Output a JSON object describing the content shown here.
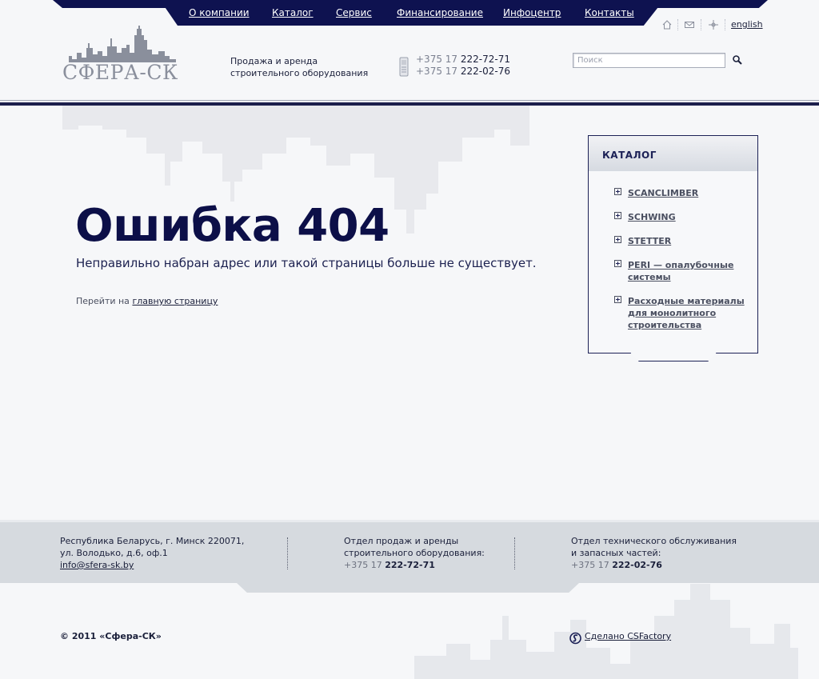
{
  "nav": {
    "items": [
      {
        "label": "О компании"
      },
      {
        "label": "Каталог"
      },
      {
        "label": "Сервис"
      },
      {
        "label": "Финансирование"
      },
      {
        "label": "Инфоцентр"
      },
      {
        "label": "Контакты"
      }
    ]
  },
  "utility": {
    "icons": [
      "home-icon",
      "mail-icon",
      "sitemap-icon"
    ],
    "language_link": "english"
  },
  "header": {
    "logo_text": "СФЕРА-СК",
    "tagline_line1": "Продажа и аренда",
    "tagline_line2": "строительного оборудования",
    "phones": [
      {
        "code": "+375 17",
        "number": "222-72-71"
      },
      {
        "code": "+375 17",
        "number": "222-02-76"
      }
    ],
    "search": {
      "placeholder": "Поиск"
    }
  },
  "main": {
    "error_title": "Ошибка 404",
    "error_message": "Неправильно набран адрес или такой страницы больше не существует.",
    "goto_prefix": "Перейти на",
    "goto_link": "главную страницу"
  },
  "catalog": {
    "title": "КАТАЛОГ",
    "items": [
      {
        "line1": "SCANCLIMBER",
        "line2": "",
        "line3": ""
      },
      {
        "line1": "SCHWING",
        "line2": "",
        "line3": ""
      },
      {
        "line1": "STETTER",
        "line2": "",
        "line3": ""
      },
      {
        "line1": "PERI — опалубочные",
        "line2": "системы",
        "line3": ""
      },
      {
        "line1": "Расходные материалы",
        "line2": "для монолитного",
        "line3": "строительства"
      }
    ]
  },
  "footer": {
    "address": {
      "line1": "Республика Беларусь, г. Минск 220071,",
      "line2": "ул. Володько, д.6, оф.1",
      "email": "info@sfera-sk.by"
    },
    "sales": {
      "line1": "Отдел продаж и аренды",
      "line2": "строительного оборудования:",
      "code": "+375 17",
      "number": "222-72-71"
    },
    "service": {
      "line1": "Отдел технического обслуживания",
      "line2": "и запасных частей:",
      "code": "+375 17",
      "number": "222-02-76"
    },
    "copyright": "© 2011 «Сфера-СК»",
    "made_by": "Сделано CSFactory"
  },
  "colors": {
    "navy": "#0e1250",
    "footer_band": "#d6dadf",
    "background": "#f6f7f9"
  }
}
